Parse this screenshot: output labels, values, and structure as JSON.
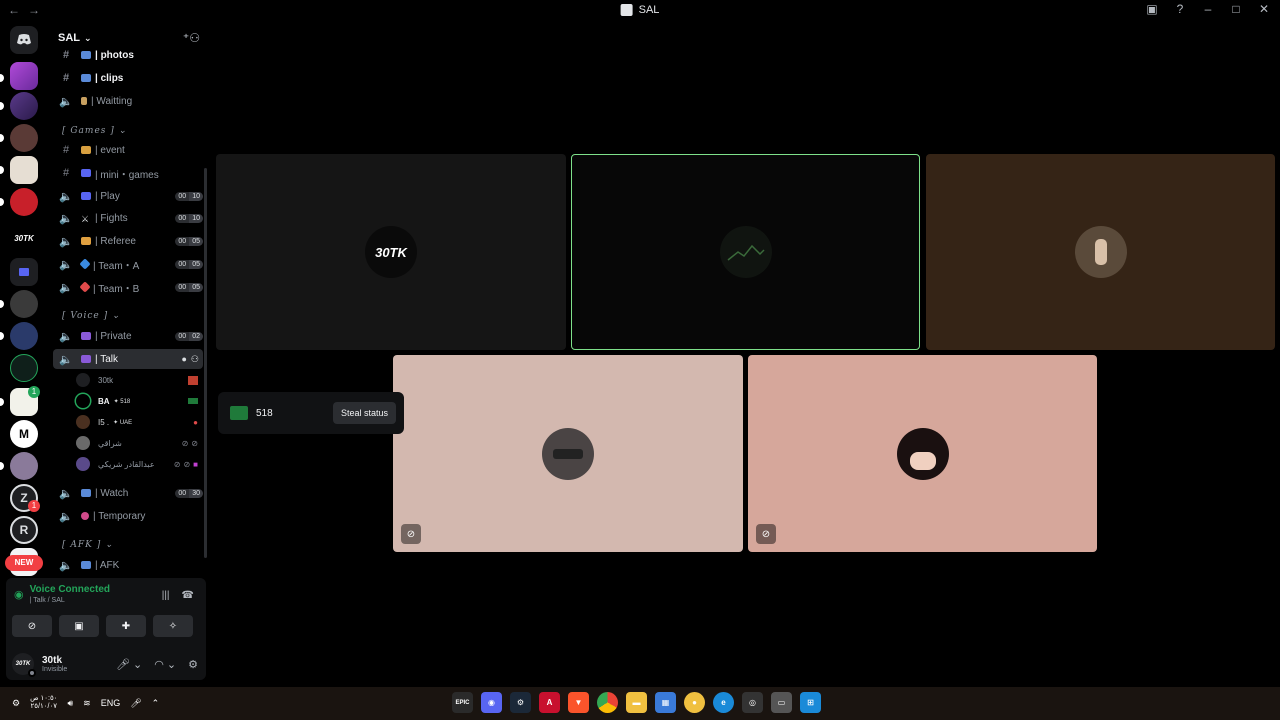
{
  "window": {
    "title": "SAL",
    "back": "←",
    "forward": "→",
    "controls": [
      "▣",
      "?",
      "–",
      "□",
      "✕"
    ]
  },
  "rail": {
    "new_label": "NEW",
    "badges": [
      "1",
      "1"
    ]
  },
  "server": {
    "name": "SAL"
  },
  "channels": {
    "photos": "| photos",
    "clips": "| clips",
    "waiting": "| Waitting",
    "cat_games": "[ Games ]",
    "event": "| event",
    "mini_games": "| mini・games",
    "play": "| Play",
    "fights": "| Fights",
    "referee": "| Referee",
    "team_a": "| Team・A",
    "team_b": "| Team・B",
    "cat_voice": "[ Voice ]",
    "private": "| Private",
    "talk": "| Talk",
    "watch": "| Watch",
    "temporary": "| Temporary",
    "cat_afk": "[ AFK ]",
    "afk": "| AFK",
    "counts": {
      "play": [
        "00",
        "10"
      ],
      "fights": [
        "00",
        "10"
      ],
      "referee": [
        "00",
        "05"
      ],
      "team_a": [
        "00",
        "05"
      ],
      "team_b": [
        "00",
        "05"
      ],
      "private": [
        "00",
        "02"
      ],
      "watch": [
        "00",
        "30"
      ]
    }
  },
  "members": [
    {
      "name": "30tk",
      "tag": ""
    },
    {
      "name": "BA",
      "tag": "✦ 518"
    },
    {
      "name": "I5 .",
      "tag": "✦ UAE"
    },
    {
      "name": "شراقي",
      "tag": ""
    },
    {
      "name": "عبدالقادر شريكي",
      "tag": ""
    }
  ],
  "voice": {
    "status": "Voice Connected",
    "location": "| Talk / SAL"
  },
  "user": {
    "name": "30tk",
    "status": "Invisible",
    "avatar_text": "30TK"
  },
  "stage": {
    "tile1_avatar_text": "30TK"
  },
  "popup": {
    "number": "518",
    "button": "Steal status"
  },
  "taskbar": {
    "lang": "ENG",
    "time": "١٠:٥٠ ص",
    "date": "٢٥/١٠/٠٧"
  },
  "colors": {
    "speaking": "#23a55a",
    "tile_grey": "#151515",
    "tile_dark": "#070707",
    "tile_brown": "#352416",
    "tile_pink1": "#d3b8af",
    "tile_pink2": "#d6a79b"
  }
}
